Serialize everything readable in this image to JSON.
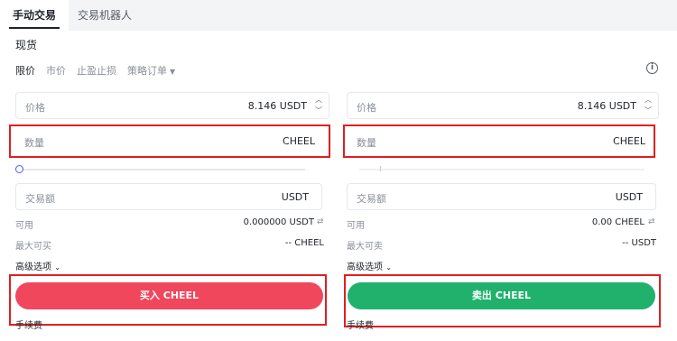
{
  "tabs": {
    "manual": "手动交易",
    "bot": "交易机器人"
  },
  "section_title": "现货",
  "order_types": {
    "limit": "限价",
    "market": "市价",
    "tpsl": "止盈止损",
    "strategy": "策略订单"
  },
  "buy": {
    "price_label": "价格",
    "price_value": "8.146 USDT",
    "amount_label": "数量",
    "amount_unit": "CHEEL",
    "total_label": "交易额",
    "total_unit": "USDT",
    "available_label": "可用",
    "available_value": "0.000000 USDT",
    "max_label": "最大可买",
    "max_value": "-- CHEEL",
    "advanced": "高级选项",
    "button": "买入 CHEEL",
    "fee": "手续费"
  },
  "sell": {
    "price_label": "价格",
    "price_value": "8.146 USDT",
    "amount_label": "数量",
    "amount_unit": "CHEEL",
    "total_label": "交易额",
    "total_unit": "USDT",
    "available_label": "可用",
    "available_value": "0.00 CHEEL",
    "max_label": "最大可卖",
    "max_value": "-- USDT",
    "advanced": "高级选项",
    "button": "卖出 CHEEL",
    "fee": "手续费"
  },
  "colors": {
    "buy": "#f0475d",
    "sell": "#20b26c",
    "highlight": "#e02020",
    "slider": "#4a5cf0"
  },
  "icons": {
    "info": "info-circle-icon",
    "swap": "swap-icon",
    "chevron": "chevron-down-icon",
    "stepper": "stepper-icon"
  }
}
